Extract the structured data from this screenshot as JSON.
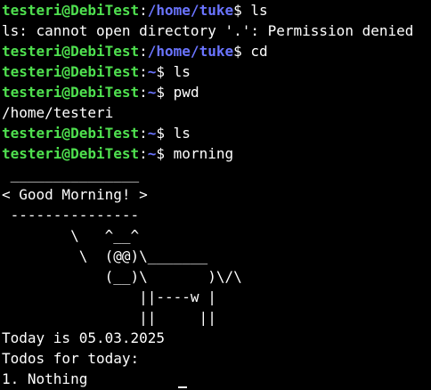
{
  "prompt": {
    "user_host": "testeri@DebiTest",
    "colon": ":",
    "dollar": "$ "
  },
  "session": [
    {
      "path": "/home/tuke",
      "command": "ls"
    },
    {
      "output": "ls: cannot open directory '.': Permission denied"
    },
    {
      "path": "/home/tuke",
      "command": "cd"
    },
    {
      "path": "~",
      "command": "ls"
    },
    {
      "path": "~",
      "command": "pwd"
    },
    {
      "output": "/home/testeri"
    },
    {
      "path": "~",
      "command": "ls"
    },
    {
      "path": "~",
      "command": "morning"
    },
    {
      "output": " _______________"
    },
    {
      "output": "< Good Morning! >"
    },
    {
      "output": " ---------------"
    },
    {
      "output": "        \\   ^__^"
    },
    {
      "output": "         \\  (@@)\\_______"
    },
    {
      "output": "            (__)\\       )\\/\\"
    },
    {
      "output": "                ||----w |"
    },
    {
      "output": "                ||     ||"
    },
    {
      "output": "Today is 05.03.2025"
    },
    {
      "output": "Todos for today:"
    },
    {
      "output": "1. Nothing"
    }
  ]
}
